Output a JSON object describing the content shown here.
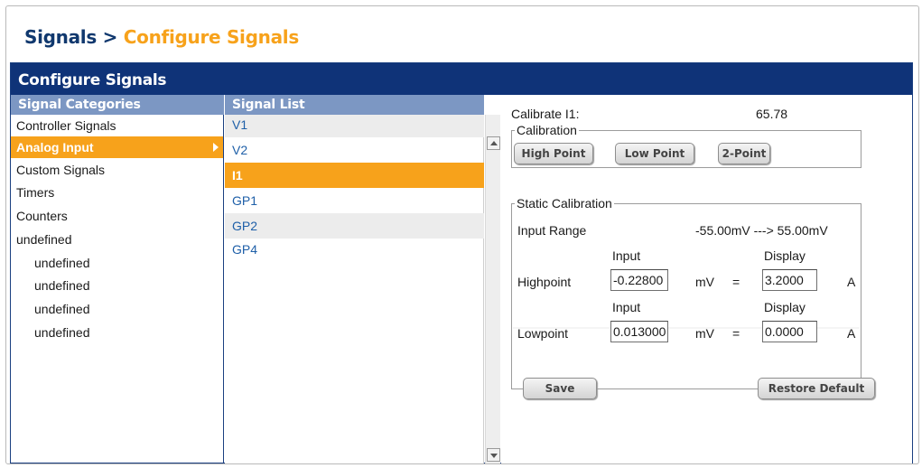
{
  "breadcrumb": {
    "root": "Signals",
    "separator": ">",
    "current": "Configure Signals"
  },
  "panel": {
    "title": "Configure Signals"
  },
  "categories": {
    "header": "Signal Categories",
    "items": [
      {
        "label": "Controller Signals"
      },
      {
        "label": "Analog Input",
        "selected": true
      },
      {
        "label": "Custom Signals"
      },
      {
        "label": "Timers"
      },
      {
        "label": "Counters"
      },
      {
        "label": "undefined"
      },
      {
        "label": "undefined",
        "sub": true
      },
      {
        "label": "undefined",
        "sub": true
      },
      {
        "label": "undefined",
        "sub": true
      },
      {
        "label": "undefined",
        "sub": true
      }
    ]
  },
  "signals": {
    "header": "Signal List",
    "items": [
      {
        "label": "V1"
      },
      {
        "label": "V2"
      },
      {
        "label": "I1",
        "selected": true
      },
      {
        "label": "GP1"
      },
      {
        "label": "GP2"
      },
      {
        "label": "GP4"
      }
    ]
  },
  "calibrate": {
    "label": "Calibrate  I1:",
    "value": "65.78"
  },
  "calibration": {
    "legend": "Calibration",
    "high_point": "High Point",
    "low_point": "Low Point",
    "two_point": "2-Point"
  },
  "static_calibration": {
    "legend": "Static Calibration",
    "input_range_label": "Input Range",
    "input_range_value": "-55.00mV ---> 55.00mV",
    "input_header": "Input",
    "display_header": "Display",
    "highpoint": {
      "label": "Highpoint",
      "input": "-0.22800",
      "unit": "mV",
      "eq": "=",
      "display": "3.2000",
      "display_unit": "A"
    },
    "lowpoint": {
      "label": "Lowpoint",
      "input": "0.013000",
      "unit": "mV",
      "eq": "=",
      "display": "0.0000",
      "display_unit": "A"
    },
    "save": "Save",
    "restore_default": "Restore Default"
  },
  "colors": {
    "header_blue": "#0f3378",
    "accent_orange": "#f7a21b",
    "subheader_blue": "#7c97c3",
    "link_blue": "#1e5fa8"
  },
  "icons": {
    "submenu_arrow": "triangle-right-icon",
    "scroll_up": "scroll-up-icon",
    "scroll_down": "scroll-down-icon"
  }
}
